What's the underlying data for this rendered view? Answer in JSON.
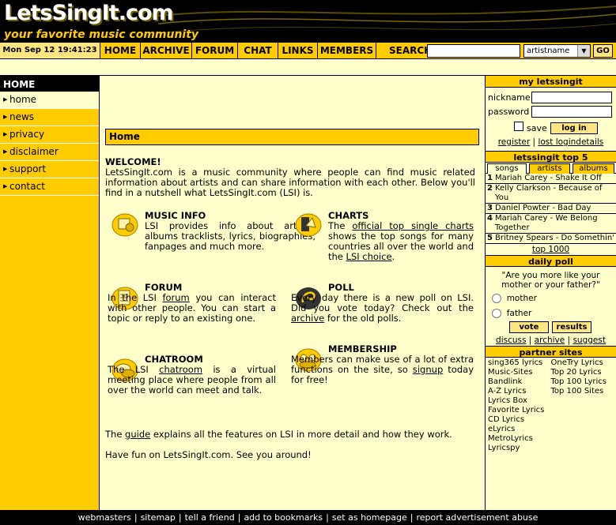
{
  "header": {
    "logo": "LetsSingIt.com",
    "tagline": "your favorite music community"
  },
  "navbar": {
    "datetime": "Mon Sep 12  19:41:23",
    "items": [
      "HOME",
      "ARCHIVE",
      "FORUM",
      "CHAT",
      "LINKS",
      "MEMBERS"
    ],
    "search_label": "SEARCH",
    "search_value": "",
    "search_select": "artistname",
    "go_label": "GO"
  },
  "leftnav": {
    "heading": "HOME",
    "items": [
      "home",
      "news",
      "privacy",
      "disclaimer",
      "support",
      "contact"
    ]
  },
  "main": {
    "bar_title": "Home",
    "welcome_title": "WELCOME!",
    "welcome_text": "LetsSingIt.com is a music community where people can find music related information about artists and can share information with each other. Below you'll find in a nutshell what LetsSingIt.com (LSI) is.",
    "features": {
      "music": {
        "title": "MUSIC INFO",
        "text": "LSI provides info about artists; albums tracklists, lyrics, biographies, fanpages and much more."
      },
      "charts": {
        "title": "CHARTS",
        "pre": "The ",
        "link1": "official top single charts",
        "mid": " shows the top songs for many countries all over the world and the ",
        "link2": "LSI choice",
        "post": "."
      },
      "forum": {
        "title": "FORUM",
        "pre": "In the LSI ",
        "link": "forum",
        "post": " you can interact with other people. You can start a topic or reply to an existing one."
      },
      "poll": {
        "title": "POLL",
        "pre": "Every day there is a new poll on LSI. Did you vote today? Check out the ",
        "link": "archive",
        "post": " for the old polls."
      },
      "chat": {
        "title": "CHATROOM",
        "pre": "The LSI ",
        "link": "chatroom",
        "post": " is a virtual meeting place where people from all over the world can meet and talk."
      },
      "membership": {
        "title": "MEMBERSHIP",
        "pre": "Members can make use of a lot of extra functions on the site, so ",
        "link": "signup",
        "post": " today for free!"
      }
    },
    "guide_pre": "The ",
    "guide_link": "guide",
    "guide_post": " explains all the features on LSI in more detail and how they work.",
    "fun_text": "Have fun on LetsSingIt.com. See you around!"
  },
  "right": {
    "my_title": "my letssingit",
    "nickname_label": "nickname",
    "password_label": "password",
    "save_label": "save",
    "login_label": "log in",
    "register_link": "register",
    "lost_link": "lost logindetails",
    "top5_title": "letssingit top 5",
    "tabs": [
      "songs",
      "artists",
      "albums"
    ],
    "top5": [
      {
        "n": "1",
        "text": "Mariah Carey - Shake It Off"
      },
      {
        "n": "2",
        "text": "Kelly Clarkson - Because of You"
      },
      {
        "n": "3",
        "text": "Daniel Powter - Bad Day"
      },
      {
        "n": "4",
        "text": "Mariah Carey - We Belong Together"
      },
      {
        "n": "5",
        "text": "Britney Spears - Do Somethin'"
      }
    ],
    "top1000": "top 1000",
    "poll_title": "daily poll",
    "poll_question": "\"Are you more like your mother or your father?\"",
    "poll_options": [
      "mother",
      "father"
    ],
    "vote_label": "vote",
    "results_label": "results",
    "poll_links": [
      "discuss",
      "archive",
      "suggest"
    ],
    "partners_title": "partner sites",
    "partners_col1": [
      "sing365 lyrics",
      "Music-Sites",
      "Bandlink",
      "A-Z Lyrics",
      "Lyrics Box",
      "Favorite Lyrics",
      "CD Lyrics",
      "eLyrics",
      "MetroLyrics",
      "Lyricspy"
    ],
    "partners_col2": [
      "OneTry Lyrics",
      "Top 20 Lyrics",
      "Top 100 Lyrics",
      "Top 100 Sites"
    ]
  },
  "footer": [
    "webmasters",
    "sitemap",
    "tell a friend",
    "add to bookmarks",
    "set as homepage",
    "report advertisement abuse"
  ]
}
